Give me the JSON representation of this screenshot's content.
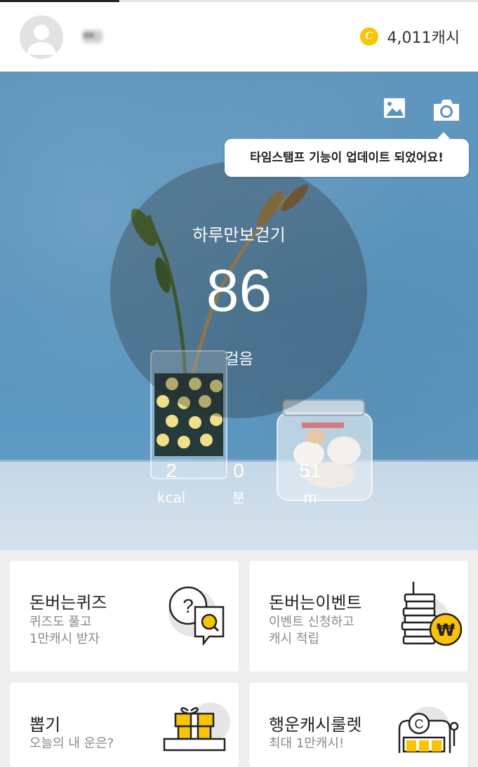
{
  "header": {
    "username": "**",
    "cash": "4,011캐시",
    "coin_symbol": "C"
  },
  "hero": {
    "tooltip": "타임스탬프 기능이 업데이트 되었어요!",
    "title": "하루만보걷기",
    "steps": "86",
    "steps_unit": "걸음",
    "stats": [
      {
        "value": "2",
        "unit": "kcal"
      },
      {
        "value": "0",
        "unit": "분"
      },
      {
        "value": "51",
        "unit": "m"
      }
    ]
  },
  "cards": [
    {
      "title": "돈버는퀴즈",
      "sub1": "퀴즈도 풀고",
      "sub2": "1만캐시 받자"
    },
    {
      "title": "돈버는이벤트",
      "sub1": "이벤트 신청하고",
      "sub2": "캐시 적립"
    },
    {
      "title": "뽑기",
      "sub1": "오늘의 내 운은?",
      "sub2": ""
    },
    {
      "title": "행운캐시룰렛",
      "sub1": "최대 1만캐시!",
      "sub2": ""
    }
  ],
  "colors": {
    "accent": "#fbc400",
    "hero_blue": "#5a94bd"
  }
}
